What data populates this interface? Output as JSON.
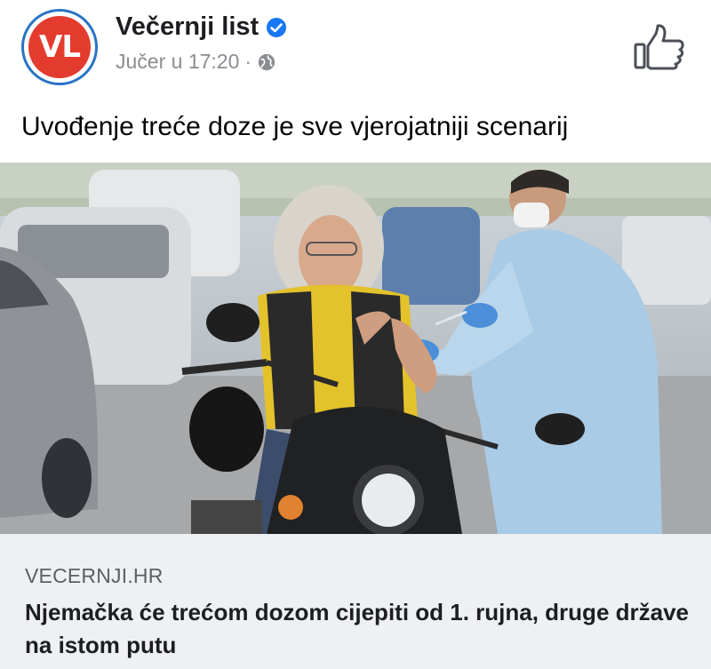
{
  "post": {
    "page_name": "Večernji list",
    "avatar_text": "VL",
    "timestamp": "Jučer u 17:20",
    "separator": "·",
    "text": "Uvođenje treće doze je sve vjerojatniji scenarij"
  },
  "link": {
    "domain": "VECERNJI.HR",
    "headline": "Njemačka će trećom dozom cijepiti od 1. rujna, druge države na istom putu"
  },
  "icons": [
    "verified-badge-icon",
    "globe-icon",
    "thumbs-up-icon"
  ],
  "colors": {
    "avatar_red": "#e43b2f",
    "avatar_ring": "#2a74c4",
    "verified_blue": "#1877f2",
    "meta_gray": "#8a8d91",
    "card_bg": "#eff0f2"
  }
}
